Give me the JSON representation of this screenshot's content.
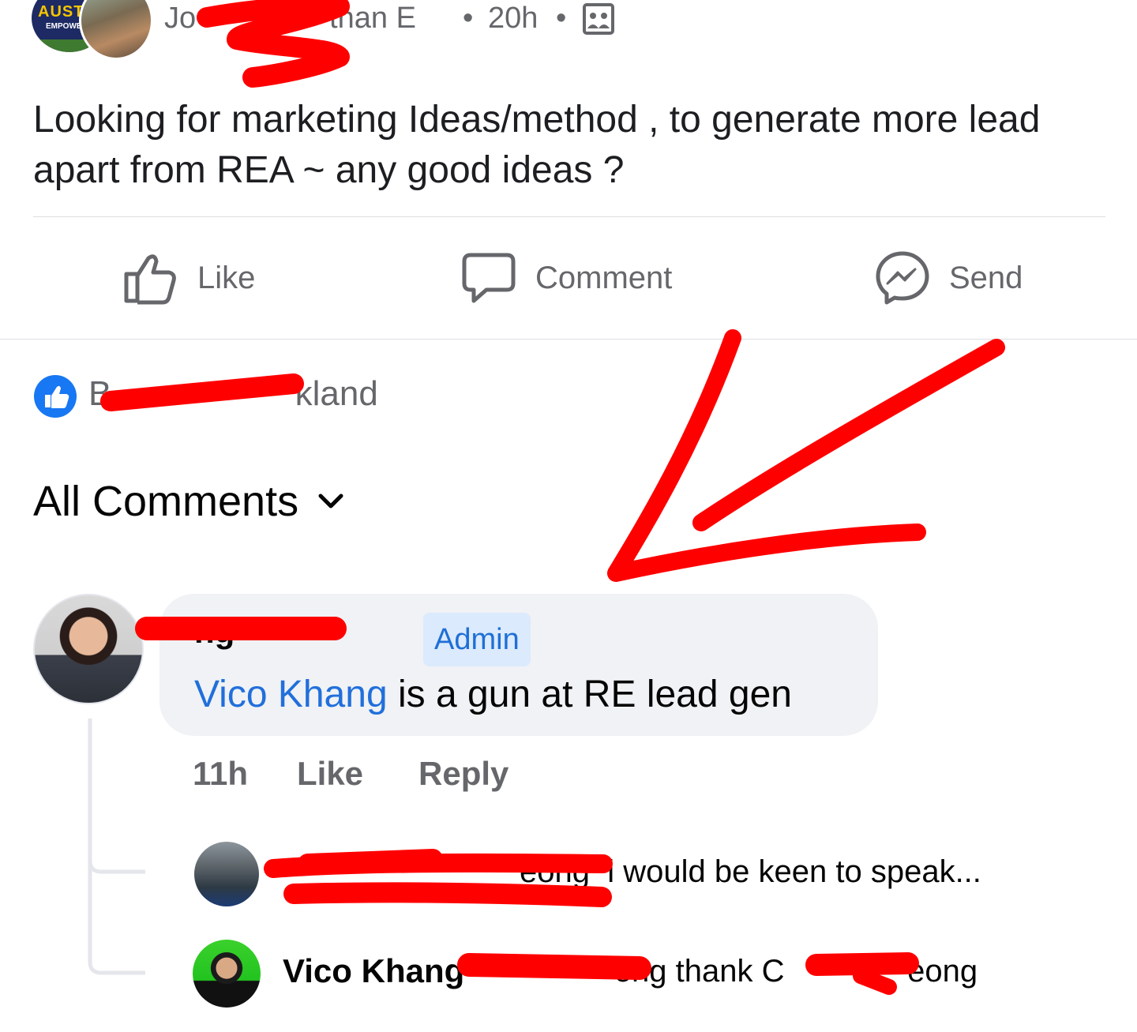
{
  "post": {
    "group_badge_line1": "AUST",
    "group_badge_line2": "EMPOWE",
    "author_visible": "Jo                than E",
    "separator": "•",
    "time": "20h",
    "text": "Looking for marketing Ideas/method , to generate more lead apart from REA ~ any good ideas ?"
  },
  "actions": {
    "like_label": "Like",
    "comment_label": "Comment",
    "send_label": "Send"
  },
  "reactions": {
    "reactor_visible": "B                   kland"
  },
  "comments_filter": {
    "label": "All Comments"
  },
  "comment": {
    "author_visible": "ng",
    "admin_badge": "Admin",
    "mention": "Vico Khang",
    "text_rest": " is a gun at RE lead gen",
    "time": "11h",
    "like_label": "Like",
    "reply_label": "Reply"
  },
  "replies": [
    {
      "text_visible": "                           eong  i would be keen to speak..."
    },
    {
      "name": "Vico Khang",
      "text_visible": "                ong thank C              eong"
    }
  ],
  "colors": {
    "accent_blue": "#216fdb",
    "secondary_text": "#65676b",
    "bubble_bg": "#f0f2f5",
    "annotation_red": "#ff0000"
  }
}
